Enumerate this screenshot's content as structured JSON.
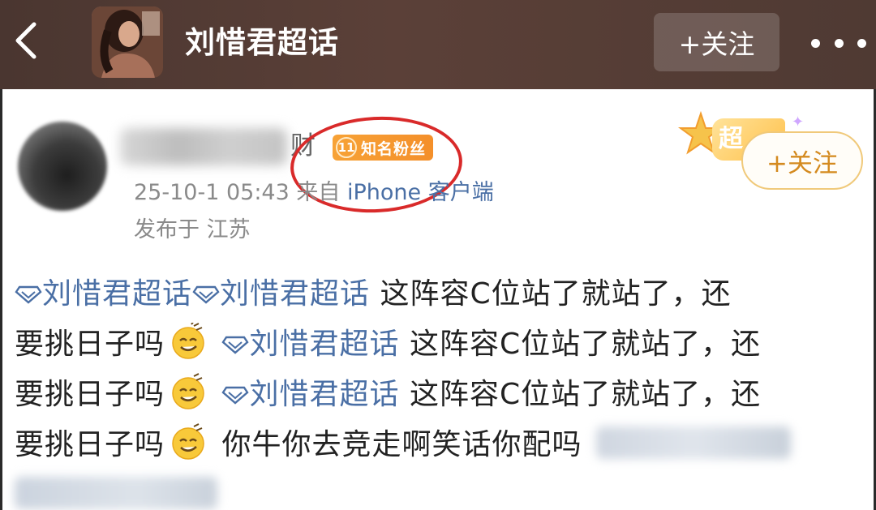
{
  "header": {
    "title": "刘惜君超话",
    "follow_label": "+关注",
    "back_icon": "chevron-left-icon",
    "more_icon": "more-dots-icon",
    "background_color": "#4f3a33"
  },
  "post": {
    "author": {
      "name_suffix": "财",
      "badge_level": "11",
      "badge_text": "知名粉丝",
      "badge_color": "#f59a30"
    },
    "meta": {
      "time": "25-10-1 05:43",
      "source_prefix": "来自",
      "device": "iPhone 客户端",
      "location": "发布于 江苏"
    },
    "decoration_text": "超",
    "follow_label": "+关注",
    "body": {
      "topic": "刘惜君超话",
      "phrase": "这阵容C位站了就站了，还",
      "phrase_tail": "要挑日子吗",
      "closing": "你牛你去竞走啊笑话你配吗"
    },
    "link_color": "#4a6fa5",
    "highlight_circle_color": "#d92a2a"
  }
}
